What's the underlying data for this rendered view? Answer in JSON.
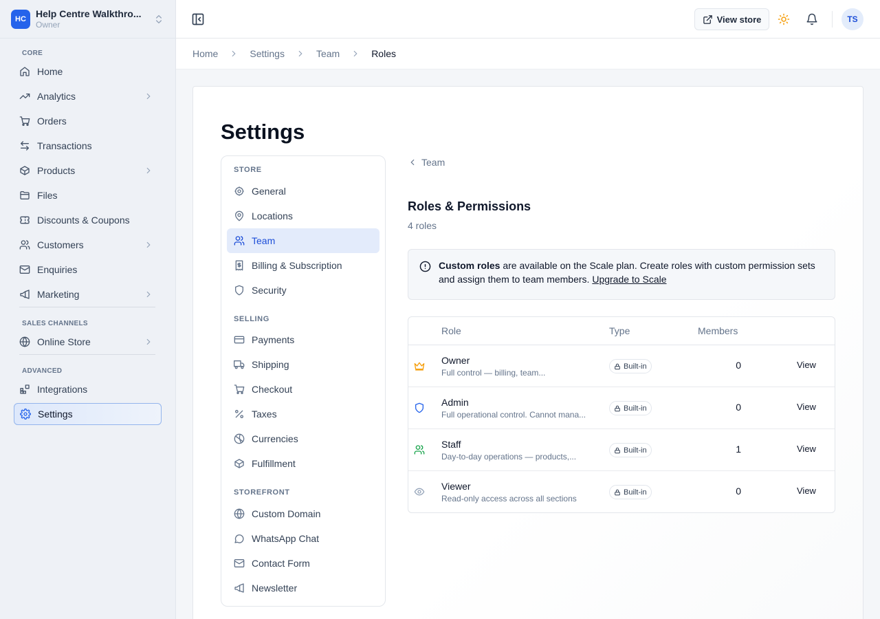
{
  "workspace": {
    "initials": "HC",
    "name": "Help Centre Walkthro...",
    "role": "Owner"
  },
  "sidebar": {
    "sections": [
      {
        "label": "CORE"
      },
      {
        "label": "SALES CHANNELS"
      },
      {
        "label": "ADVANCED"
      }
    ],
    "items": [
      {
        "label": "Home",
        "icon": "home-icon"
      },
      {
        "label": "Analytics",
        "icon": "trend-icon",
        "has_children": true
      },
      {
        "label": "Orders",
        "icon": "cart-icon"
      },
      {
        "label": "Transactions",
        "icon": "arrows-icon"
      },
      {
        "label": "Products",
        "icon": "box-icon",
        "has_children": true
      },
      {
        "label": "Files",
        "icon": "folder-icon"
      },
      {
        "label": "Discounts & Coupons",
        "icon": "ticket-icon"
      },
      {
        "label": "Customers",
        "icon": "users-icon",
        "has_children": true
      },
      {
        "label": "Enquiries",
        "icon": "mail-icon"
      },
      {
        "label": "Marketing",
        "icon": "megaphone-icon",
        "has_children": true
      },
      {
        "label": "Online Store",
        "icon": "globe-icon",
        "has_children": true
      },
      {
        "label": "Integrations",
        "icon": "blocks-icon"
      },
      {
        "label": "Settings",
        "icon": "gear-icon",
        "active": true
      }
    ]
  },
  "topbar": {
    "view_store_label": "View store",
    "avatar_initials": "TS"
  },
  "breadcrumb": [
    "Home",
    "Settings",
    "Team",
    "Roles"
  ],
  "settings": {
    "title": "Settings",
    "nav": {
      "store_label": "STORE",
      "selling_label": "SELLING",
      "storefront_label": "STOREFRONT",
      "store": [
        "General",
        "Locations",
        "Team",
        "Billing & Subscription",
        "Security"
      ],
      "selling": [
        "Payments",
        "Shipping",
        "Checkout",
        "Taxes",
        "Currencies",
        "Fulfillment"
      ],
      "storefront": [
        "Custom Domain",
        "WhatsApp Chat",
        "Contact Form",
        "Newsletter"
      ]
    }
  },
  "roles_page": {
    "back_label": "Team",
    "title": "Roles & Permissions",
    "count": "4 roles",
    "notice": {
      "bold": "Custom roles",
      "text": " are available on the Scale plan. Create roles with custom permission sets and assign them to team members. ",
      "link": "Upgrade to Scale"
    },
    "columns": {
      "role": "Role",
      "type": "Type",
      "members": "Members"
    },
    "rows": [
      {
        "name": "Owner",
        "description": "Full control — billing, team...",
        "type": "Built-in",
        "members": "0",
        "action": "View",
        "icon": "crown-icon",
        "icon_color": "#f59e0b"
      },
      {
        "name": "Admin",
        "description": "Full operational control. Cannot mana...",
        "type": "Built-in",
        "members": "0",
        "action": "View",
        "icon": "shield-icon",
        "icon_color": "#2563eb"
      },
      {
        "name": "Staff",
        "description": "Day-to-day operations — products,...",
        "type": "Built-in",
        "members": "1",
        "action": "View",
        "icon": "users-icon",
        "icon_color": "#16a34a"
      },
      {
        "name": "Viewer",
        "description": "Read-only access across all sections",
        "type": "Built-in",
        "members": "0",
        "action": "View",
        "icon": "eye-icon",
        "icon_color": "#94a3b8"
      }
    ]
  },
  "colors": {
    "accent": "#2563eb",
    "sidebar_bg": "#eef1f6",
    "active_nav_bg": "#e3ebfb"
  }
}
